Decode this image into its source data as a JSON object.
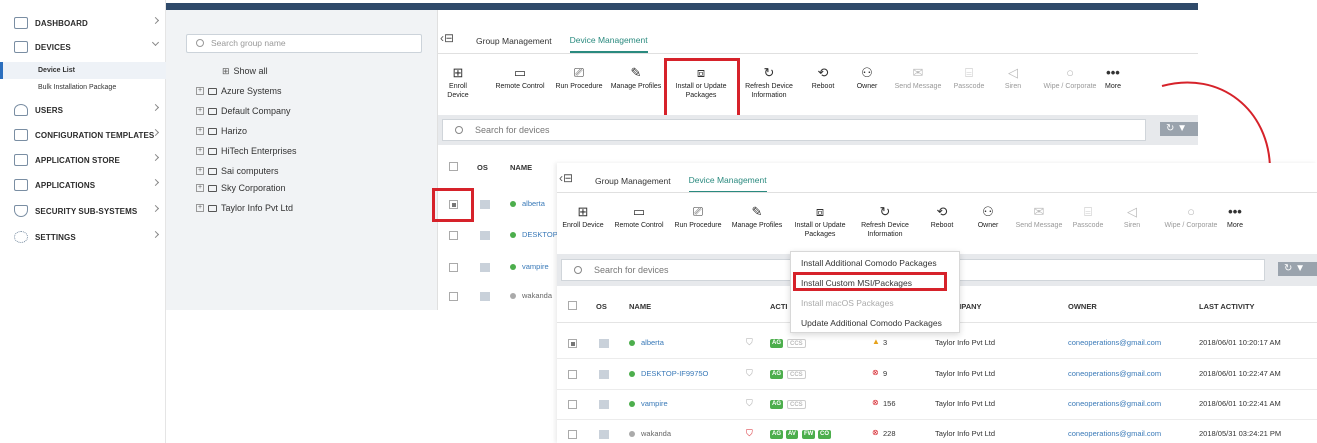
{
  "sidebar": {
    "items": [
      {
        "label": "DASHBOARD",
        "icon": "dashboard-icon"
      },
      {
        "label": "DEVICES",
        "icon": "devices-icon"
      },
      {
        "label": "USERS",
        "icon": "users-icon"
      },
      {
        "label": "CONFIGURATION TEMPLATES",
        "icon": "templates-icon"
      },
      {
        "label": "APPLICATION STORE",
        "icon": "store-icon"
      },
      {
        "label": "APPLICATIONS",
        "icon": "applications-icon"
      },
      {
        "label": "SECURITY SUB-SYSTEMS",
        "icon": "shield-icon"
      },
      {
        "label": "SETTINGS",
        "icon": "gear-icon"
      }
    ],
    "sub_items": [
      "Device List",
      "Bulk Installation Package"
    ]
  },
  "groups": {
    "search_placeholder": "Search group name",
    "show_all": "Show all",
    "items": [
      "Azure Systems",
      "Default Company",
      "Harizo",
      "HiTech Enterprises",
      "Sai computers",
      "Sky Corporation",
      "Taylor Info Pvt Ltd"
    ]
  },
  "tabs": [
    "Group Management",
    "Device Management"
  ],
  "toolbar": [
    {
      "label": "Enroll Device",
      "icon": "enroll-icon"
    },
    {
      "label": "Remote Control",
      "icon": "monitor-icon"
    },
    {
      "label": "Run Procedure",
      "icon": "procedure-icon"
    },
    {
      "label": "Manage Profiles",
      "icon": "profiles-icon"
    },
    {
      "label": "Install or Update\nPackages",
      "icon": "install-icon"
    },
    {
      "label": "Refresh Device\nInformation",
      "icon": "refresh-icon"
    },
    {
      "label": "Reboot",
      "icon": "reboot-icon"
    },
    {
      "label": "Owner",
      "icon": "owner-icon"
    },
    {
      "label": "Send Message",
      "icon": "message-icon"
    },
    {
      "label": "Passcode",
      "icon": "passcode-icon"
    },
    {
      "label": "Siren",
      "icon": "siren-icon"
    },
    {
      "label": "Wipe / Corporate",
      "icon": "wipe-icon"
    },
    {
      "label": "More",
      "icon": "more-icon"
    }
  ],
  "device_search_placeholder": "Search for devices",
  "columns": {
    "os": "OS",
    "name": "NAME",
    "actions": "ACTI",
    "company": "MPANY",
    "owner": "OWNER",
    "last_activity": "LAST ACTIVITY"
  },
  "devices": [
    {
      "name": "alberta",
      "status_color": "#4cae4c",
      "badges": [
        "AG",
        "CCS"
      ],
      "alert": "3",
      "alert_type": "warning",
      "company": "Taylor Info Pvt Ltd",
      "owner": "coneoperations@gmail.com",
      "last_activity": "2018/06/01 10:20:17 AM"
    },
    {
      "name": "DESKTOP-IF9975O",
      "status_color": "#4cae4c",
      "badges": [
        "AG",
        "CCS"
      ],
      "alert": "9",
      "alert_type": "error",
      "company": "Taylor Info Pvt Ltd",
      "owner": "coneoperations@gmail.com",
      "last_activity": "2018/06/01 10:22:47 AM"
    },
    {
      "name": "vampire",
      "status_color": "#4cae4c",
      "badges": [
        "AG",
        "CCS"
      ],
      "alert": "156",
      "alert_type": "error",
      "company": "Taylor Info Pvt Ltd",
      "owner": "coneoperations@gmail.com",
      "last_activity": "2018/06/01 10:22:41 AM"
    },
    {
      "name": "wakanda",
      "status_color": "#aaaaaa",
      "badges": [
        "AG",
        "AV",
        "FW",
        "CO"
      ],
      "alert": "228",
      "alert_type": "error",
      "company": "Taylor Info Pvt Ltd",
      "owner": "coneoperations@gmail.com",
      "last_activity": "2018/05/31 03:24:21 PM"
    }
  ],
  "back_devices_visible": [
    "alberta",
    "DESKTOP-",
    "vampire",
    "wakanda"
  ],
  "install_menu": {
    "items": [
      {
        "label": "Install Additional Comodo Packages",
        "disabled": false
      },
      {
        "label": "Install Custom MSI/Packages",
        "disabled": false
      },
      {
        "label": "Install macOS Packages",
        "disabled": true
      },
      {
        "label": "Update Additional Comodo Packages",
        "disabled": false
      }
    ]
  },
  "colors": {
    "accent": "#2a8a7f",
    "highlight": "#d6222a",
    "link": "#3a7ab8",
    "topbar": "#2f4a6a"
  }
}
